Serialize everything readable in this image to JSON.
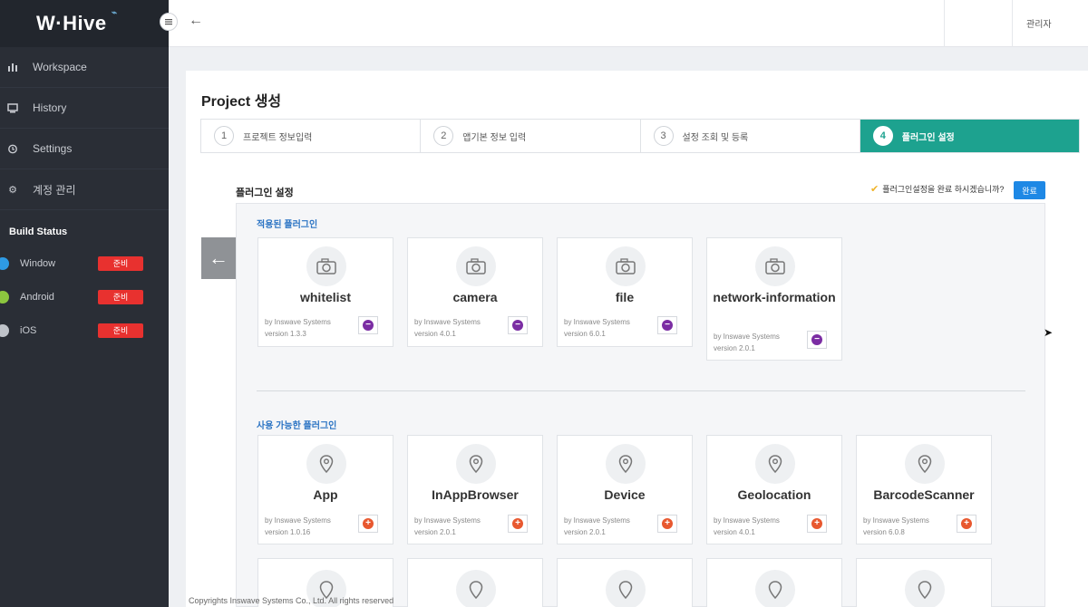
{
  "brand": {
    "logo": "W·Hive"
  },
  "sidebar": {
    "items": [
      {
        "label": "Workspace",
        "icon": "bar-chart-icon"
      },
      {
        "label": "History",
        "icon": "monitor-icon"
      },
      {
        "label": "Settings",
        "icon": "alarm-clock-icon"
      },
      {
        "label": "계정 관리",
        "icon": "gear-icon"
      }
    ],
    "build_title": "Build Status",
    "builds": [
      {
        "os": "Window",
        "status": "준비",
        "icon_color": "#2e9be5"
      },
      {
        "os": "Android",
        "status": "준비",
        "icon_color": "#8cc63f"
      },
      {
        "os": "iOS",
        "status": "준비",
        "icon_color": "#bfc3c9"
      }
    ]
  },
  "header": {
    "back": "←",
    "user": "관리자"
  },
  "page": {
    "title": "Project 생성",
    "steps": [
      {
        "num": "1",
        "label": "프로젝트 정보입력",
        "active": false
      },
      {
        "num": "2",
        "label": "앱기본 정보 입력",
        "active": false
      },
      {
        "num": "3",
        "label": "설정 조회 및 등록",
        "active": false
      },
      {
        "num": "4",
        "label": "플러그인 설정",
        "active": true
      }
    ],
    "section_label": "플러그인 설정",
    "confirm_text": "플러그인설정을 완료 하시겠습니까?",
    "done_label": "완료",
    "applied_label": "적용된 플러그인",
    "available_label": "사용 가능한 플러그인",
    "applied": [
      {
        "name": "whitelist",
        "by": "by Inswave Systems",
        "version": "version 1.3.3"
      },
      {
        "name": "camera",
        "by": "by Inswave Systems",
        "version": "version 4.0.1"
      },
      {
        "name": "file",
        "by": "by Inswave Systems",
        "version": "version 6.0.1"
      },
      {
        "name": "network-information",
        "by": "by Inswave Systems",
        "version": "version 2.0.1"
      }
    ],
    "available": [
      {
        "name": "App",
        "by": "by Inswave Systems",
        "version": "version 1.0.16"
      },
      {
        "name": "InAppBrowser",
        "by": "by Inswave Systems",
        "version": "version 2.0.1"
      },
      {
        "name": "Device",
        "by": "by Inswave Systems",
        "version": "version 2.0.1"
      },
      {
        "name": "Geolocation",
        "by": "by Inswave Systems",
        "version": "version 4.0.1"
      },
      {
        "name": "BarcodeScanner",
        "by": "by Inswave Systems",
        "version": "version 6.0.8"
      }
    ]
  },
  "footer": "Copyrights Inswave Systems Co., Ltd. All rights reserved",
  "colors": {
    "accent": "#1da28f",
    "badge": "#e8312f",
    "link": "#2a73c3",
    "remove": "#7b2da3",
    "add": "#e8582f"
  }
}
